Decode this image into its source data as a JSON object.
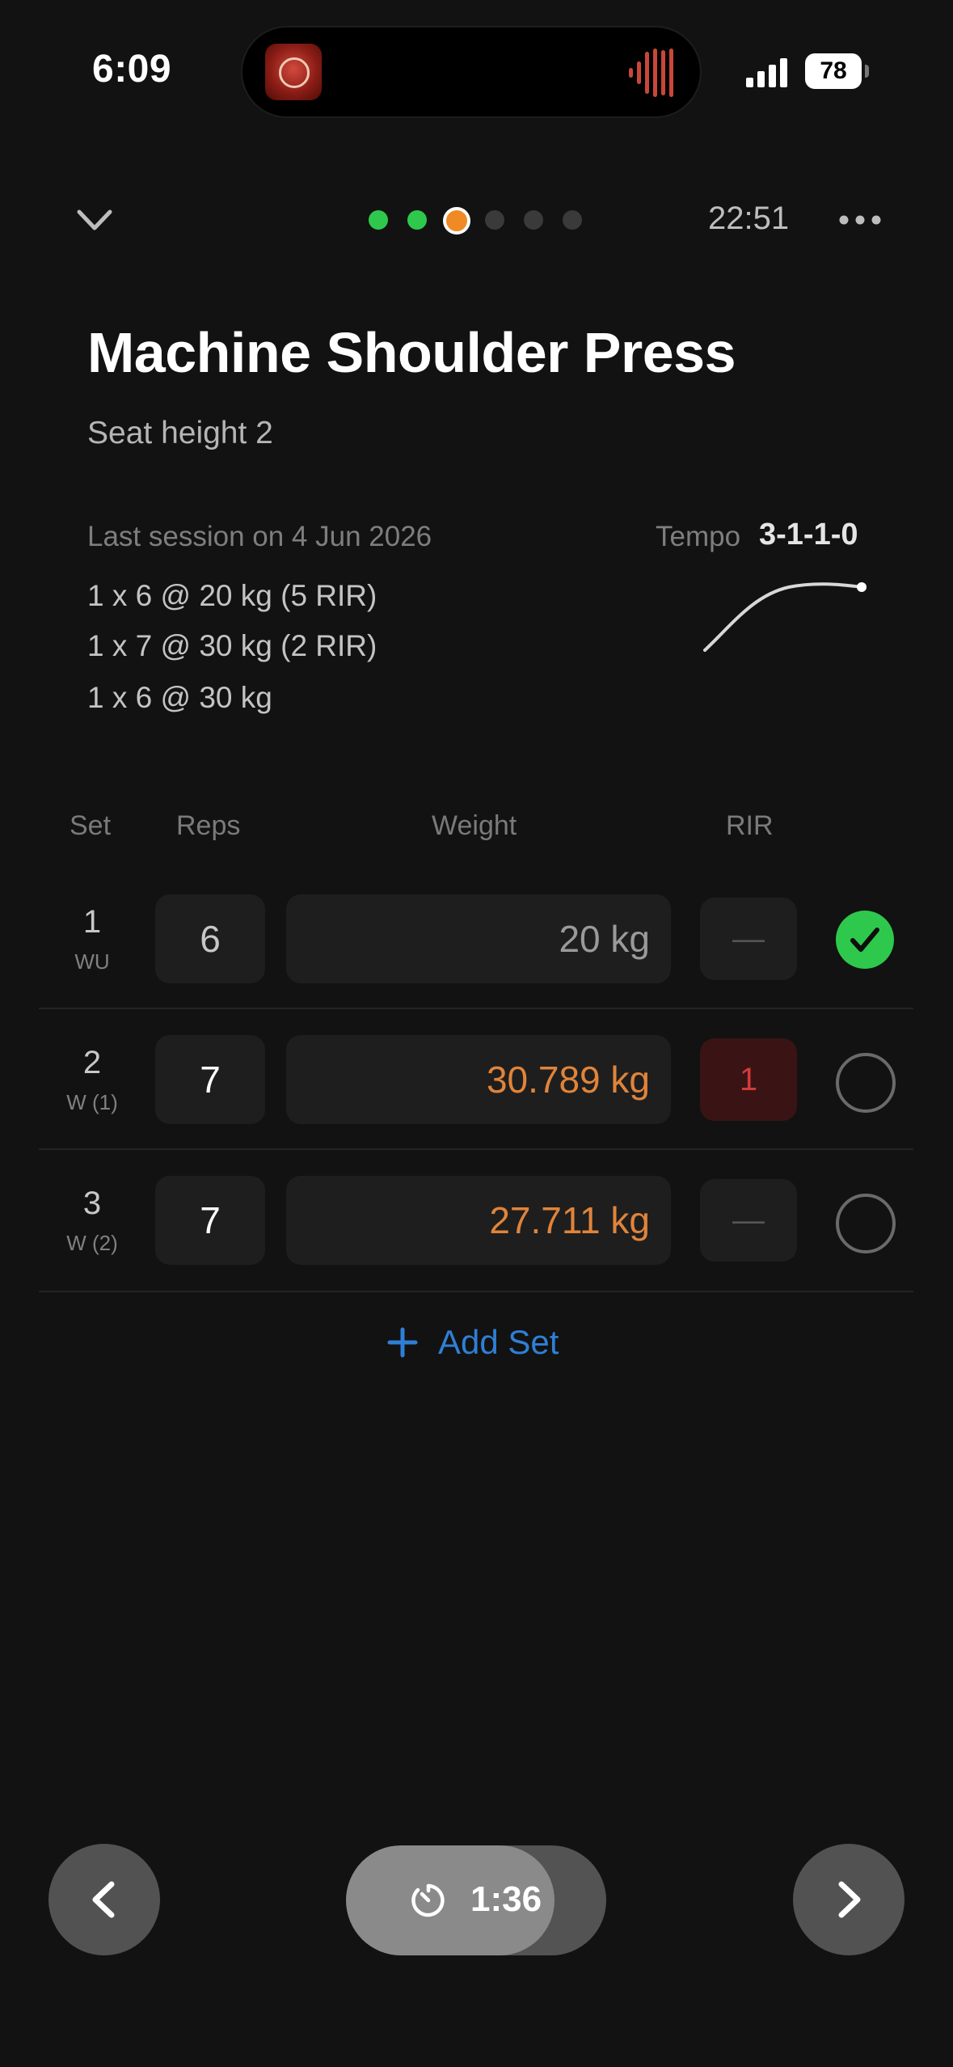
{
  "status_bar": {
    "time": "6:09",
    "battery": "78"
  },
  "header": {
    "elapsed": "22:51",
    "progress_dots": [
      "done",
      "done",
      "current",
      "pending",
      "pending",
      "pending"
    ]
  },
  "exercise": {
    "title": "Machine Shoulder Press",
    "note": "Seat height 2",
    "last_session_label": "Last session on 4 Jun 2026",
    "last_session": [
      "1 x 6 @ 20 kg (5 RIR)",
      "1 x 7 @ 30 kg (2 RIR)",
      "1 x 6 @ 30 kg"
    ],
    "tempo_label": "Tempo",
    "tempo": "3-1-1-0"
  },
  "table": {
    "headers": {
      "set": "Set",
      "reps": "Reps",
      "weight": "Weight",
      "rir": "RIR"
    },
    "rows": [
      {
        "set": "1",
        "type": "WU",
        "reps": "6",
        "weight": "20 kg",
        "rir": "—",
        "done": true
      },
      {
        "set": "2",
        "type": "W (1)",
        "reps": "7",
        "weight": "30.789 kg",
        "rir": "1",
        "done": false
      },
      {
        "set": "3",
        "type": "W (2)",
        "reps": "7",
        "weight": "27.711 kg",
        "rir": "—",
        "done": false
      }
    ],
    "add_set": "Add Set"
  },
  "rest_timer": {
    "time": "1:36",
    "progress": 0.8
  },
  "colors": {
    "done": "#2ec94c",
    "current": "#f08a24",
    "suggested_weight": "#e0843a",
    "link": "#2f7fd6",
    "rir_alert": "#d43a3a"
  }
}
